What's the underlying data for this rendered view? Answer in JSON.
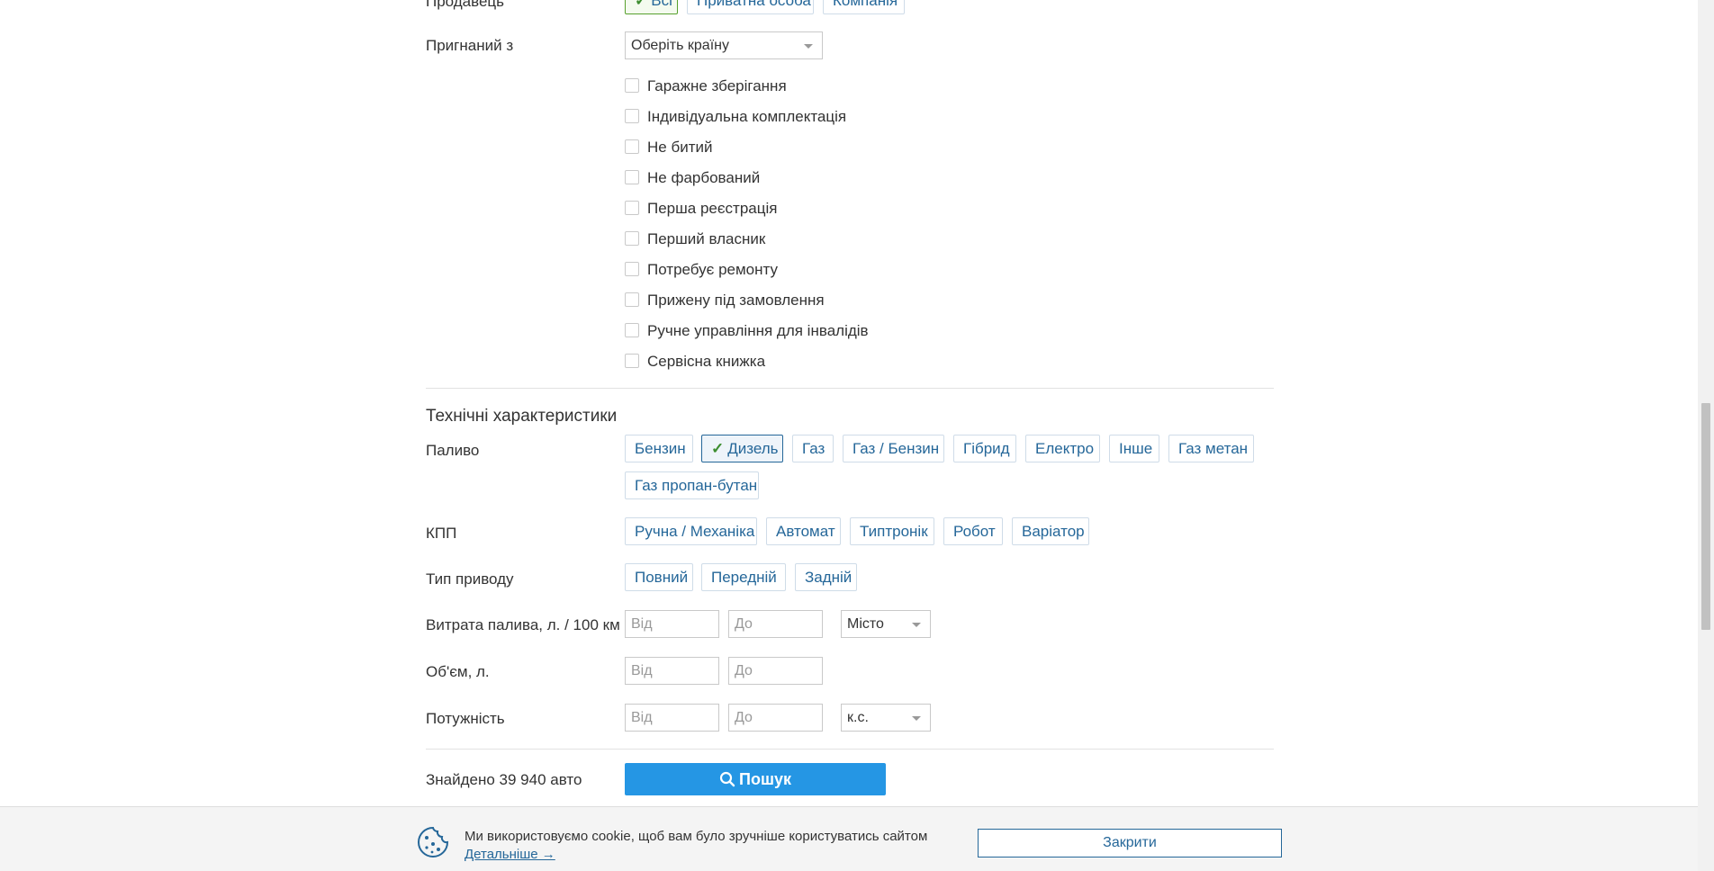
{
  "seller": {
    "label": "Продавець",
    "options": [
      {
        "label": "Всі",
        "selected": true
      },
      {
        "label": "Приватна особа",
        "selected": false
      },
      {
        "label": "Компанія",
        "selected": false
      }
    ]
  },
  "imported_from": {
    "label": "Пригнаний з",
    "select_value": "Оберіть країну"
  },
  "checkboxes": [
    {
      "label": "Гаражне зберігання",
      "checked": false
    },
    {
      "label": "Індивідуальна комплектація",
      "checked": false
    },
    {
      "label": "Не битий",
      "checked": false
    },
    {
      "label": "Не фарбований",
      "checked": false
    },
    {
      "label": "Перша реєстрація",
      "checked": false
    },
    {
      "label": "Перший власник",
      "checked": false
    },
    {
      "label": "Потребує ремонту",
      "checked": false
    },
    {
      "label": "Прижену під замовлення",
      "checked": false
    },
    {
      "label": "Ручне управління для інвалідів",
      "checked": false
    },
    {
      "label": "Сервісна книжка",
      "checked": false
    }
  ],
  "technical": {
    "title": "Технічні характеристики",
    "fuel": {
      "label": "Паливо",
      "options": [
        {
          "label": "Бензин",
          "selected": false
        },
        {
          "label": "Дизель",
          "selected": true
        },
        {
          "label": "Газ",
          "selected": false
        },
        {
          "label": "Газ / Бензин",
          "selected": false
        },
        {
          "label": "Гібрид",
          "selected": false
        },
        {
          "label": "Електро",
          "selected": false
        },
        {
          "label": "Інше",
          "selected": false
        },
        {
          "label": "Газ метан",
          "selected": false
        },
        {
          "label": "Газ пропан-бутан",
          "selected": false
        }
      ]
    },
    "gearbox": {
      "label": "КПП",
      "options": [
        "Ручна / Механіка",
        "Автомат",
        "Типтронік",
        "Робот",
        "Варіатор"
      ]
    },
    "drive": {
      "label": "Тип приводу",
      "options": [
        "Повний",
        "Передній",
        "Задній"
      ]
    },
    "consumption": {
      "label": "Витрата палива, л. / 100 км",
      "from_placeholder": "Від",
      "to_placeholder": "До",
      "mode_value": "Місто"
    },
    "volume": {
      "label": "Об'єм, л.",
      "from_placeholder": "Від",
      "to_placeholder": "До"
    },
    "power": {
      "label": "Потужність",
      "from_placeholder": "Від",
      "to_placeholder": "До",
      "unit_value": "к.с."
    }
  },
  "results": {
    "found_text": "Знайдено 39 940 авто",
    "search_label": "Пошук"
  },
  "cookie": {
    "text": "Ми використовуємо cookie, щоб вам було зручніше користуватись сайтом",
    "link": "Детальніше →",
    "close_label": "Закрити"
  },
  "colors": {
    "link_blue": "#256799",
    "primary_button": "#2596e4",
    "check_green": "#3c8d2f"
  }
}
